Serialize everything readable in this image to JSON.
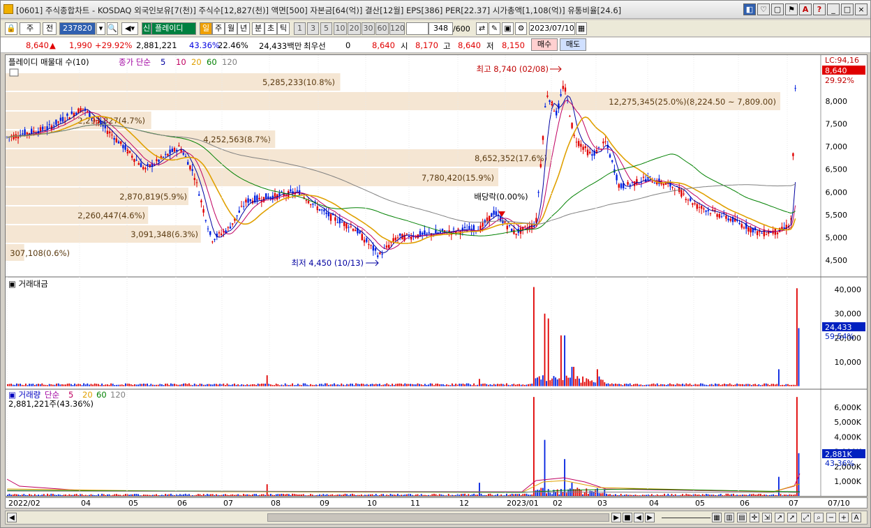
{
  "window": {
    "title": "[0601] 주식종합차트 - KOSDAQ 외국인보유[7(천)] 주식수[12,827(천)] 액면[500] 자본금[64(억)] 결산[12월] EPS[386] PER[22.37] 시가총액[1,108(억)] 유통비율[24.6]",
    "buttons": [
      "◧",
      "♡",
      "▢",
      "⚑",
      "A",
      "?",
      "_",
      "□",
      "×"
    ]
  },
  "toolbar": {
    "period": "주",
    "prev_label": "전",
    "code": "237820",
    "source_label": "신",
    "stock_name": "플레이디",
    "period_tabs": [
      "일",
      "주",
      "월",
      "년",
      "분",
      "초",
      "틱"
    ],
    "intervals": [
      "1",
      "3",
      "5",
      "10",
      "20",
      "30",
      "60",
      "120"
    ],
    "count": "348",
    "count_total": "/600",
    "date": "2023/07/10"
  },
  "quote": {
    "price": "8,640",
    "change": "1,990",
    "change_pct": "+29.92%",
    "volume": "2,881,221",
    "vol_ratio": "43.36%",
    "turnover": "22.46%",
    "amount": "24,433백만",
    "priority": "최우선",
    "zero": "0",
    "best_price": "8,640",
    "open_label": "시",
    "open": "8,170",
    "high_label": "고",
    "high": "8,640",
    "low_label": "저",
    "low": "8,150",
    "buy_label": "매수",
    "sell_label": "매도"
  },
  "price_pane": {
    "legend_name": "플레이디 매물대 수(10)",
    "ma_label": "종가 단순",
    "ma_periods": [
      "5",
      "10",
      "20",
      "60",
      "120"
    ],
    "lc_label": "LC:94,16",
    "last_price": "8,640",
    "last_pct": "29.92%",
    "high_note": "최고 8,740 (02/08)",
    "low_note": "최저 4,450 (10/13)",
    "dividend_note": "배당락(0.00%)",
    "volume_profile": [
      "5,285,233(10.8%)",
      "12,275,345(25.0%)(8,224.50 ~ 7,809.00)",
      "2,293,827(4.7%)",
      "4,252,563(8.7%)",
      "8,652,352(17.6%)",
      "7,780,420(15.9%)",
      "2,870,819(5.9%)",
      "2,260,447(4.6%)",
      "3,091,348(6.3%)",
      "307,108(0.6%)"
    ],
    "y_ticks": [
      "8,000",
      "7,500",
      "7,000",
      "6,500",
      "6,000",
      "5,500",
      "5,000",
      "4,500"
    ]
  },
  "amount_pane": {
    "legend_name": "거래대금",
    "y_ticks": [
      "40,000",
      "30,000",
      "20,000",
      "10,000"
    ],
    "last_value": "24,433",
    "last_pct": "59.54%"
  },
  "volume_pane": {
    "legend_name": "거래량",
    "ma_label": "단순",
    "ma_periods": [
      "5",
      "20",
      "60",
      "120"
    ],
    "current": "2,881,221주(43.36%)",
    "y_ticks": [
      "6,000K",
      "5,000K",
      "4,000K",
      "3,000K",
      "2,000K",
      "1,000K"
    ],
    "last_value": "2,881K",
    "last_pct": "43.36%"
  },
  "x_axis": [
    "2022/02",
    "04",
    "05",
    "06",
    "07",
    "08",
    "09",
    "10",
    "11",
    "12",
    "2023/01",
    "02",
    "03",
    "04",
    "05",
    "06",
    "07",
    "07/10"
  ],
  "colors": {
    "up": "#e00000",
    "down": "#0020e0",
    "ma5": "#0000a0",
    "ma10": "#c00060",
    "ma20": "#e0a000",
    "ma60": "#008000",
    "ma120": "#808080",
    "profile": "#f5e6d3"
  },
  "chart_data": {
    "type": "candlestick",
    "title": "플레이디",
    "high": 8740,
    "low": 4450,
    "last_close": 8640,
    "volume_profile_pct": [
      10.8,
      25.0,
      4.7,
      8.7,
      17.6,
      15.9,
      5.9,
      4.6,
      6.3,
      0.6
    ]
  }
}
